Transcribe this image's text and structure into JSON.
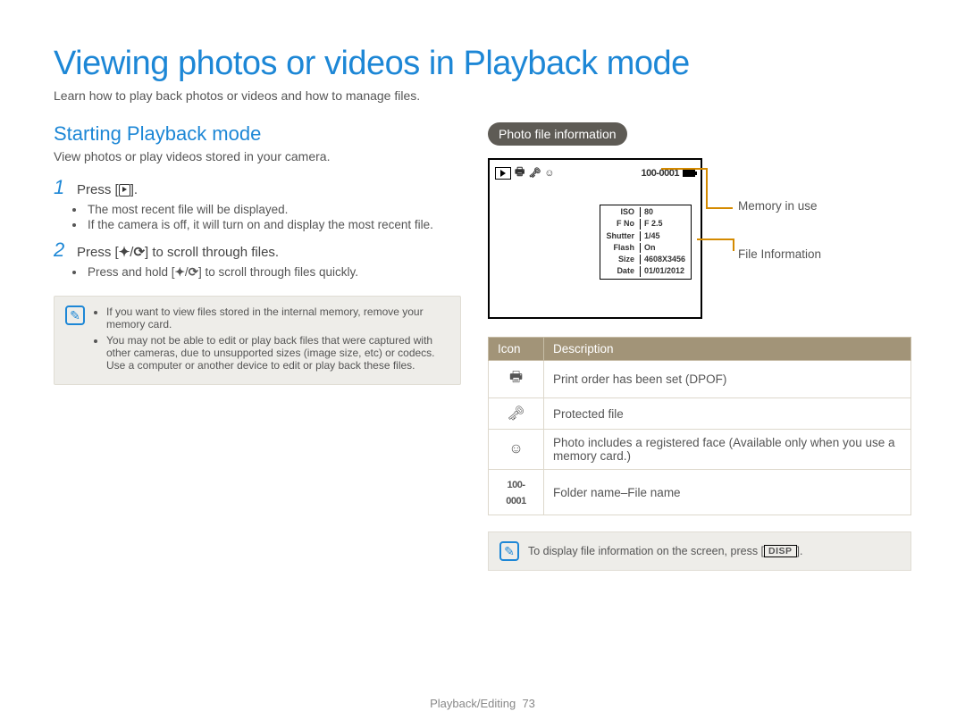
{
  "page_title": "Viewing photos or videos in Playback mode",
  "page_intro": "Learn how to play back photos or videos and how to manage files.",
  "left": {
    "section_title": "Starting Playback mode",
    "section_sub": "View photos or play videos stored in your camera.",
    "step1_pre": "Press [",
    "step1_post": "].",
    "step1_bullets": [
      "The most recent file will be displayed.",
      "If the camera is off, it will turn on and display the most recent file."
    ],
    "step2_pre": "Press [",
    "step2_mid": "/",
    "step2_post": "] to scroll through files.",
    "step2_bullet_pre": "Press and hold [",
    "step2_bullet_mid": "/",
    "step2_bullet_post": "] to scroll through files quickly.",
    "flash_char": "✦",
    "timer_char": "⟳",
    "notes": [
      "If you want to view files stored in the internal memory, remove your memory card.",
      "You may not be able to edit or play back files that were captured with other cameras, due to unsupported sizes (image size, etc) or codecs. Use a computer or another device to edit or play back these files."
    ]
  },
  "right": {
    "pill": "Photo file information",
    "screen": {
      "folder_file": "100-0001",
      "info_rows": [
        {
          "label": "ISO",
          "value": "80"
        },
        {
          "label": "F No",
          "value": "F 2.5"
        },
        {
          "label": "Shutter",
          "value": "1/45"
        },
        {
          "label": "Flash",
          "value": "On"
        },
        {
          "label": "Size",
          "value": "4608X3456"
        },
        {
          "label": "Date",
          "value": "01/01/2012"
        }
      ]
    },
    "callouts": {
      "memory": "Memory in use",
      "fileinfo": "File Information"
    },
    "table": {
      "head_icon": "Icon",
      "head_desc": "Description",
      "rows": [
        {
          "icon": "print",
          "desc": "Print order has been set (DPOF)"
        },
        {
          "icon": "key",
          "desc": "Protected file"
        },
        {
          "icon": "face",
          "desc": "Photo includes a registered face (Available only when you use a memory card.)"
        },
        {
          "icon": "folderfile",
          "desc": "Folder name–File name"
        }
      ],
      "folderfile_text": "100-0001"
    },
    "tip_pre": "To display file information on the screen, press [",
    "tip_disp": "DISP",
    "tip_post": "]."
  },
  "footer": {
    "section": "Playback/Editing",
    "page": "73"
  }
}
